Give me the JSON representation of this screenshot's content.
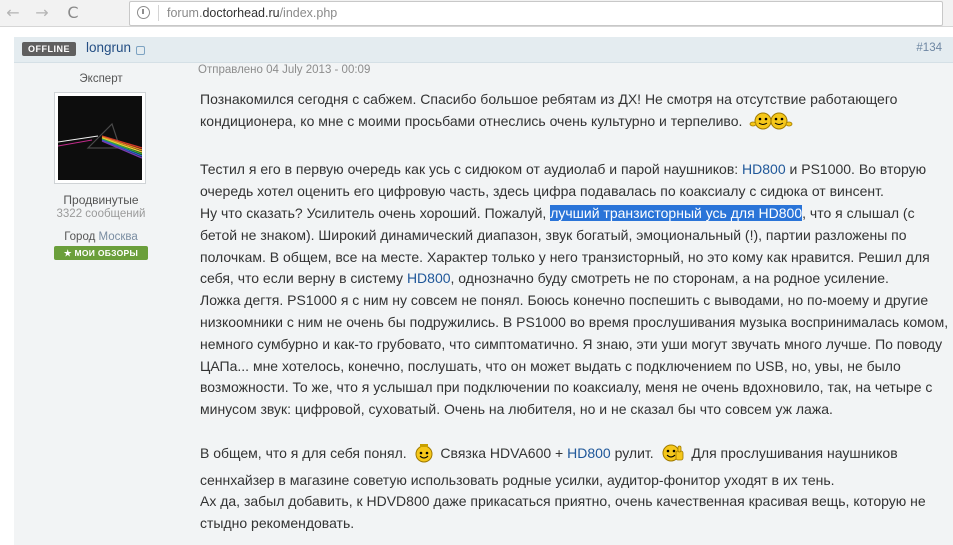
{
  "browser": {
    "back_icon": "←",
    "forward_icon": "→",
    "reload_icon": "C",
    "url_prefix": "forum.",
    "url_domain": "doctorhead.ru",
    "url_path": "/index.php"
  },
  "post": {
    "status_badge": "OFFLINE",
    "author": "longrun",
    "number": "#134",
    "date": "Отправлено 04 July 2013 - 00:09",
    "rank": "Эксперт",
    "group": "Продвинутые",
    "post_count": "3322 сообщений",
    "city_label": "Город",
    "city": "Москва",
    "reviews_label": "МОИ ОБЗОРЫ",
    "reviews_icon": "★"
  },
  "content": {
    "p1": "Познакомился сегодня с сабжем. Спасибо большое ребятам из ДХ! Не смотря на отсутствие работающего кондиционера, ко мне с моими просьбами отнеслись очень культурно и терпеливо.",
    "p2_a": "Тестил я его в первую очередь как усь с сидюком от аудиолаб и парой наушников:",
    "p2_link1": "HD800",
    "p2_b": "и PS1000. Во вторую очередь хотел оценить его цифровую часть, здесь цифра подавалась по коаксиалу с сидюка от винсент.",
    "p3_a": "Ну что сказать? Усилитель очень хороший. Пожалуй,",
    "p3_highlight": "лучший транзисторный усь для HD800",
    "p3_b": ", что я слышал (с бетой не знаком). Широкий динамический диапазон, звук богатый, эмоциональный (!), партии разложены по полочкам. В общем, все на месте. Характер только у него транзисторный, но это кому как нравится. Решил для себя, что если верну в систему",
    "p3_link": "HD800",
    "p3_c": ", однозначно буду смотреть не по сторонам, а на родное усиление.",
    "p4": "Ложка дегтя. PS1000 я с ним ну совсем не понял. Боюсь конечно поспешить с выводами, но по-моему и другие низкоомники с ним не очень бы подружились. В PS1000 во время прослушивания музыка воспринималась комом, немного сумбурно и как-то грубовато, что симптоматично. Я знаю, эти уши могут звучать много лучше. По поводу ЦАПа... мне хотелось, конечно, послушать, что он может выдать с подключением по USB, но, увы, не было возможности. То же, что я услышал при подключении по коаксиалу, меня не очень вдохновило, так, на четыре с минусом звук: цифровой, суховатый. Очень на любителя, но и не сказал бы что совсем уж лажа.",
    "p5_a": "В общем, что я для себя понял.",
    "p5_b": "Связка HDVA600 +",
    "p5_link": "HD800",
    "p5_c": "рулит.",
    "p5_d": "Для прослушивания наушников сеннхайзер в магазине советую использовать родные усилки, аудитор-фонитор уходят в их тень.",
    "p6": "Ах да, забыл добавить, к HDVD800 даже прикасаться приятно, очень качественная красивая вещь, которую не стыдно рекомендовать."
  }
}
